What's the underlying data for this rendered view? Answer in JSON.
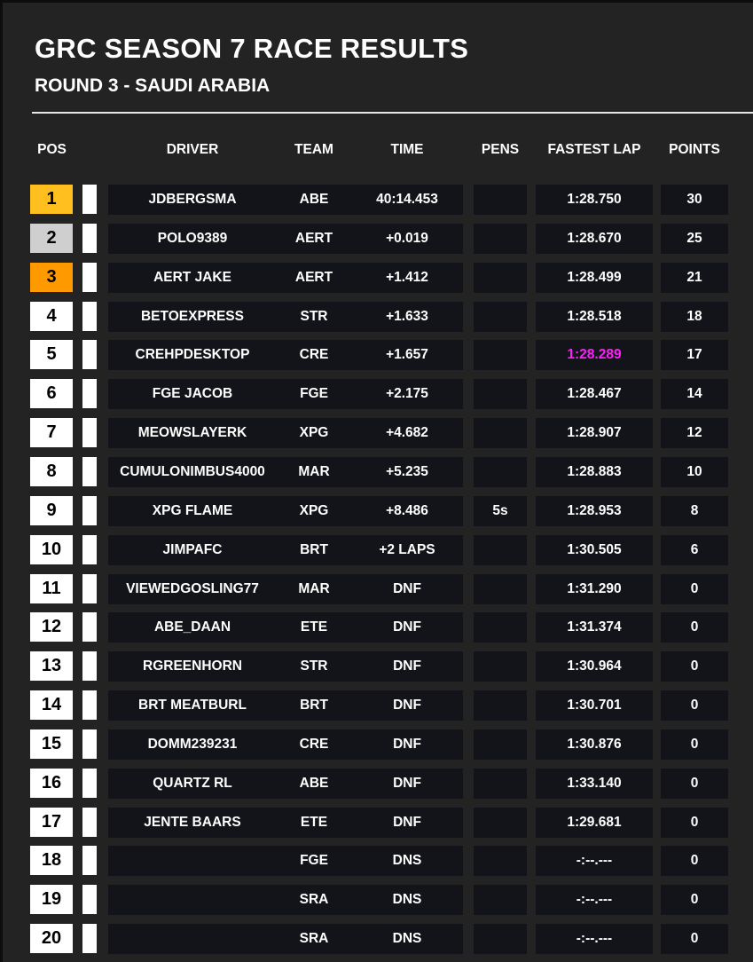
{
  "title": "GRC SEASON 7 RACE RESULTS",
  "subtitle": "ROUND 3 - SAUDI ARABIA",
  "headers": {
    "pos": "POS",
    "driver": "DRIVER",
    "team": "TEAM",
    "time": "TIME",
    "pens": "PENS",
    "fastest_lap": "FASTEST LAP",
    "points": "POINTS"
  },
  "colors": {
    "gold": "#ffbf1f",
    "silver": "#cfcfcf",
    "bronze": "#ff9900",
    "fastest_lap_highlight": "#ff1cff"
  },
  "rows": [
    {
      "pos": "1",
      "driver": "JDBERGSMA",
      "team": "ABE",
      "time": "40:14.453",
      "pens": "",
      "fastest_lap": "1:28.750",
      "points": "30"
    },
    {
      "pos": "2",
      "driver": "POLO9389",
      "team": "AERT",
      "time": "+0.019",
      "pens": "",
      "fastest_lap": "1:28.670",
      "points": "25"
    },
    {
      "pos": "3",
      "driver": "AERT JAKE",
      "team": "AERT",
      "time": "+1.412",
      "pens": "",
      "fastest_lap": "1:28.499",
      "points": "21"
    },
    {
      "pos": "4",
      "driver": "BETOEXPRESS",
      "team": "STR",
      "time": "+1.633",
      "pens": "",
      "fastest_lap": "1:28.518",
      "points": "18"
    },
    {
      "pos": "5",
      "driver": "CREHPDESKTOP",
      "team": "CRE",
      "time": "+1.657",
      "pens": "",
      "fastest_lap": "1:28.289",
      "points": "17",
      "fastest": true
    },
    {
      "pos": "6",
      "driver": "FGE JACOB",
      "team": "FGE",
      "time": "+2.175",
      "pens": "",
      "fastest_lap": "1:28.467",
      "points": "14"
    },
    {
      "pos": "7",
      "driver": "MEOWSLAYERK",
      "team": "XPG",
      "time": "+4.682",
      "pens": "",
      "fastest_lap": "1:28.907",
      "points": "12"
    },
    {
      "pos": "8",
      "driver": "CUMULONIMBUS4000",
      "team": "MAR",
      "time": "+5.235",
      "pens": "",
      "fastest_lap": "1:28.883",
      "points": "10"
    },
    {
      "pos": "9",
      "driver": "XPG FLAME",
      "team": "XPG",
      "time": "+8.486",
      "pens": "5s",
      "fastest_lap": "1:28.953",
      "points": "8"
    },
    {
      "pos": "10",
      "driver": "JIMPAFC",
      "team": "BRT",
      "time": "+2 LAPS",
      "pens": "",
      "fastest_lap": "1:30.505",
      "points": "6"
    },
    {
      "pos": "11",
      "driver": "VIEWEDGOSLING77",
      "team": "MAR",
      "time": "DNF",
      "pens": "",
      "fastest_lap": "1:31.290",
      "points": "0"
    },
    {
      "pos": "12",
      "driver": "ABE_DAAN",
      "team": "ETE",
      "time": "DNF",
      "pens": "",
      "fastest_lap": "1:31.374",
      "points": "0"
    },
    {
      "pos": "13",
      "driver": "RGREENHORN",
      "team": "STR",
      "time": "DNF",
      "pens": "",
      "fastest_lap": "1:30.964",
      "points": "0"
    },
    {
      "pos": "14",
      "driver": "BRT MEATBURL",
      "team": "BRT",
      "time": "DNF",
      "pens": "",
      "fastest_lap": "1:30.701",
      "points": "0"
    },
    {
      "pos": "15",
      "driver": "DOMM239231",
      "team": "CRE",
      "time": "DNF",
      "pens": "",
      "fastest_lap": "1:30.876",
      "points": "0"
    },
    {
      "pos": "16",
      "driver": "QUARTZ RL",
      "team": "ABE",
      "time": "DNF",
      "pens": "",
      "fastest_lap": "1:33.140",
      "points": "0"
    },
    {
      "pos": "17",
      "driver": "JENTE BAARS",
      "team": "ETE",
      "time": "DNF",
      "pens": "",
      "fastest_lap": "1:29.681",
      "points": "0"
    },
    {
      "pos": "18",
      "driver": "",
      "team": "FGE",
      "time": "DNS",
      "pens": "",
      "fastest_lap": "-:--.---",
      "points": "0"
    },
    {
      "pos": "19",
      "driver": "",
      "team": "SRA",
      "time": "DNS",
      "pens": "",
      "fastest_lap": "-:--.---",
      "points": "0"
    },
    {
      "pos": "20",
      "driver": "",
      "team": "SRA",
      "time": "DNS",
      "pens": "",
      "fastest_lap": "-:--.---",
      "points": "0"
    }
  ]
}
